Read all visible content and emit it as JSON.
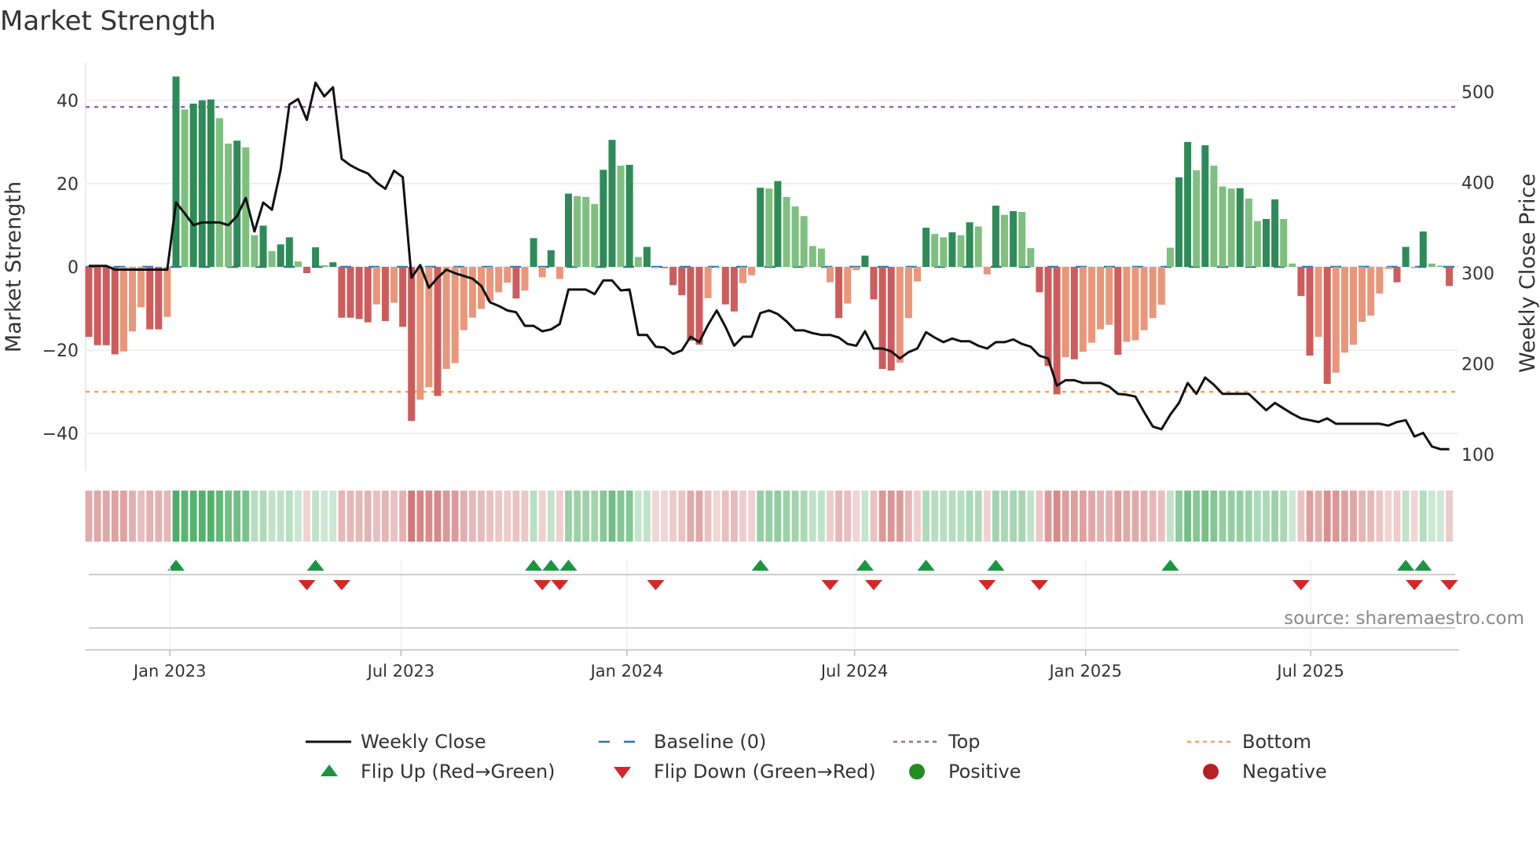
{
  "chart_data": {
    "type": "bar",
    "title": "Market Strength",
    "ylabel": "Market Strength",
    "y2label": "Weekly Close Price",
    "ylim": [
      -49,
      49
    ],
    "y2lim": [
      82,
      532
    ],
    "yticks": [
      40,
      20,
      0,
      -20,
      -40
    ],
    "ytick_labels": [
      "40",
      "20",
      "0",
      "−20",
      "−40"
    ],
    "y2ticks": [
      500,
      400,
      300,
      200,
      100
    ],
    "y2tick_labels": [
      "500",
      "400",
      "300",
      "200",
      "100"
    ],
    "xticks": [
      {
        "label": "Jan 2023",
        "week": 9.3
      },
      {
        "label": "Jul 2023",
        "week": 35.8
      },
      {
        "label": "Jan 2024",
        "week": 61.7
      },
      {
        "label": "Jul 2024",
        "week": 87.8
      },
      {
        "label": "Jan 2025",
        "week": 114.3
      },
      {
        "label": "Jul 2025",
        "week": 140.1
      }
    ],
    "top_level": 38.4,
    "bottom_level": -30,
    "baseline": 0,
    "strength": [
      -16.8,
      -18.8,
      -18.8,
      -21,
      -20.3,
      -15.5,
      -9.7,
      -15,
      -15,
      -12,
      45.7,
      37.8,
      39.2,
      40,
      40.2,
      35.7,
      29.6,
      30.3,
      28.7,
      7.6,
      9.9,
      3.8,
      5.4,
      7.1,
      1.3,
      -1.5,
      4.7,
      0.4,
      1.1,
      -12.2,
      -12.2,
      -12.5,
      -13.3,
      -9,
      -13,
      -8.6,
      -14.4,
      -37,
      -31.9,
      -28.9,
      -31,
      -24.5,
      -23.1,
      -15.2,
      -12.2,
      -10.1,
      -8.2,
      -6.1,
      -3.8,
      -7.6,
      -5.7,
      6.9,
      -2.5,
      4,
      -2.9,
      17.6,
      17,
      16.8,
      15.1,
      23.3,
      30.5,
      24.3,
      24.5,
      2.4,
      4.8,
      -0.3,
      -0.3,
      -4.4,
      -6.8,
      -17.7,
      -18.7,
      -7.5,
      -0.2,
      -9,
      -10.7,
      -3.9,
      -2,
      19,
      18.8,
      20.6,
      16.8,
      14.5,
      12.2,
      5,
      4.4,
      -3.7,
      -12.3,
      -8.8,
      -0.8,
      2.7,
      -7.8,
      -24.5,
      -24.9,
      -23,
      -12.3,
      -3.5,
      9.4,
      7.9,
      7.1,
      8.3,
      7.6,
      10.7,
      9.7,
      -1.8,
      14.7,
      12.5,
      13.4,
      13.2,
      4.5,
      -6.1,
      -23.8,
      -30.6,
      -21.7,
      -22.2,
      -20.4,
      -18.2,
      -15,
      -13.9,
      -21.1,
      -18,
      -17.6,
      -15.2,
      -12.3,
      -9.1,
      4.6,
      21.5,
      30,
      23.2,
      29.2,
      24.3,
      19.3,
      18.8,
      18.9,
      16.4,
      11,
      11.5,
      16.2,
      11.5,
      0.8,
      -7,
      -21.3,
      -16.8,
      -28.1,
      -25.4,
      -20.6,
      -18.7,
      -13.2,
      -11.7,
      -6.4,
      -0.5,
      -3.7,
      4.8,
      -0.3,
      8.5,
      0.8,
      0.3,
      -4.6
    ],
    "weekly_close": [
      308,
      308,
      308,
      304,
      304,
      304,
      304,
      304,
      304,
      304,
      378,
      366,
      353,
      356,
      356,
      356,
      353,
      363,
      383,
      346,
      378,
      370,
      414,
      486,
      492,
      469,
      510,
      495,
      505,
      426,
      419,
      414,
      410,
      400,
      393,
      413,
      406,
      295,
      309,
      284,
      295,
      304,
      300,
      297,
      294,
      286,
      268,
      264,
      259,
      257,
      242,
      242,
      236,
      238,
      244,
      282,
      282,
      282,
      277,
      292,
      292,
      281,
      282,
      232,
      232,
      219,
      218,
      211,
      215,
      230,
      224,
      243,
      259,
      241,
      220,
      230,
      230,
      256,
      259,
      255,
      247,
      237,
      237,
      234,
      232,
      232,
      229,
      222,
      220,
      236,
      217,
      217,
      214,
      206,
      213,
      217,
      235,
      229,
      224,
      228,
      225,
      225,
      220,
      217,
      224,
      224,
      227,
      222,
      219,
      209,
      206,
      176,
      182,
      182,
      179,
      179,
      179,
      175,
      167,
      166,
      164,
      147,
      131,
      128,
      144,
      157,
      179,
      167,
      185,
      177,
      167,
      167,
      167,
      167,
      158,
      149,
      157,
      151,
      145,
      140,
      138,
      136,
      140,
      134,
      134,
      134,
      134,
      134,
      134,
      132,
      136,
      138,
      120,
      124,
      109,
      106,
      106
    ],
    "flip_up_weeks": [
      10,
      26,
      51,
      53,
      55,
      77,
      89,
      96,
      104,
      124,
      151,
      153
    ],
    "flip_down_weeks": [
      25,
      29,
      52,
      54,
      65,
      85,
      90,
      103,
      109,
      139,
      152,
      156
    ],
    "legend": [
      {
        "label": "Weekly Close",
        "marker": "line"
      },
      {
        "label": "Baseline (0)",
        "marker": "dash"
      },
      {
        "label": "Top",
        "marker": "dot-line"
      },
      {
        "label": "Bottom",
        "marker": "dot-line"
      },
      {
        "label": "Flip Up (Red→Green)",
        "marker": "triangle-up"
      },
      {
        "label": "Flip Down (Green→Red)",
        "marker": "triangle-down"
      },
      {
        "label": "Positive",
        "marker": "circle"
      },
      {
        "label": "Negative",
        "marker": "circle"
      }
    ],
    "legend_placement": "bottom"
  },
  "source": "source: sharemaestro.com",
  "colors": {
    "pos_strong": "#2e8b57",
    "pos_weak": "#7fbf7f",
    "neg_strong": "#cd5c5c",
    "neg_weak": "#e9967a",
    "line": "#111111",
    "baseline": "#1f77b4",
    "top": "#9467bd",
    "bottom": "#ff9f4a",
    "flip_up": "#1a9641",
    "flip_down": "#d62728",
    "positive": "#228b22",
    "negative": "#b22222",
    "strip_pos": "#3aa655",
    "strip_neg": "#c85a5a"
  }
}
